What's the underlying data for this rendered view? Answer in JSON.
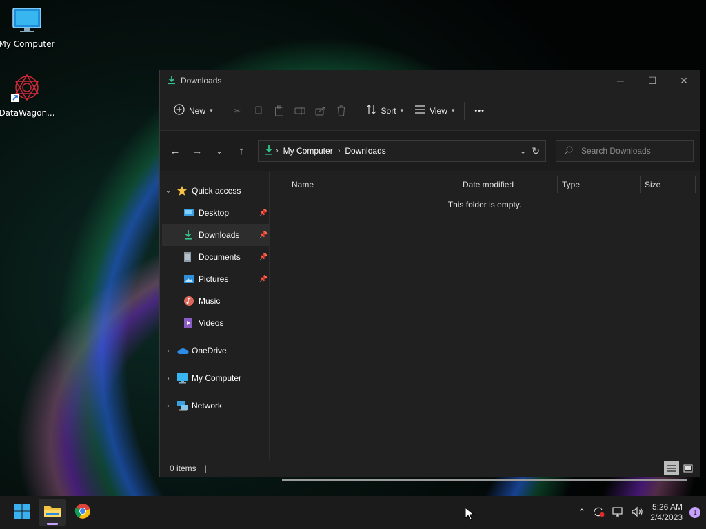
{
  "desktop": {
    "icons": [
      {
        "label": "My Computer",
        "icon": "monitor-icon"
      },
      {
        "label": "DataWagon...",
        "icon": "datawagon-shortcut-icon"
      }
    ]
  },
  "window": {
    "title": "Downloads",
    "controls": {
      "minimize": "─",
      "maximize": "☐",
      "close": "✕"
    }
  },
  "toolbar": {
    "new_label": "New",
    "sort_label": "Sort",
    "view_label": "View",
    "more_label": "•••"
  },
  "address": {
    "crumbs": [
      "My Computer",
      "Downloads"
    ]
  },
  "search": {
    "placeholder": "Search Downloads"
  },
  "sidebar": {
    "quick_access": "Quick access",
    "items": [
      {
        "label": "Desktop",
        "pinned": true
      },
      {
        "label": "Downloads",
        "pinned": true,
        "selected": true
      },
      {
        "label": "Documents",
        "pinned": true
      },
      {
        "label": "Pictures",
        "pinned": true
      },
      {
        "label": "Music",
        "pinned": false
      },
      {
        "label": "Videos",
        "pinned": false
      }
    ],
    "roots": [
      {
        "label": "OneDrive"
      },
      {
        "label": "My Computer"
      },
      {
        "label": "Network"
      }
    ]
  },
  "columns": [
    "Name",
    "Date modified",
    "Type",
    "Size"
  ],
  "content": {
    "empty_message": "This folder is empty."
  },
  "status": {
    "items_count": "0 items"
  },
  "taskbar": {
    "time": "5:26 AM",
    "date": "2/4/2023",
    "notification_count": "1"
  },
  "colors": {
    "accent": "#4cc2ff",
    "download_green": "#33c48d",
    "window_bg": "#202020",
    "taskbar_bg": "#1b1b1b"
  }
}
